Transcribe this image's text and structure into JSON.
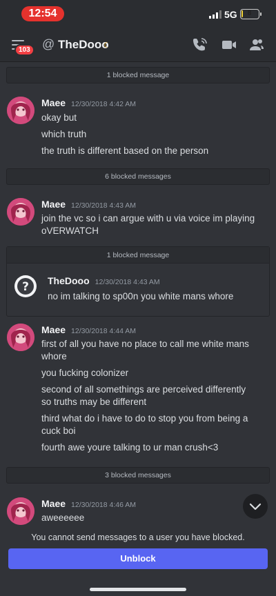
{
  "status_bar": {
    "time": "12:54",
    "network": "5G",
    "battery": "8",
    "battery_level": 0.08
  },
  "header": {
    "notification_count": "103",
    "at_symbol": "@",
    "username": "TheDooo",
    "status_glyph": "☾"
  },
  "feed": [
    {
      "kind": "blocked",
      "text": "1 blocked message"
    },
    {
      "kind": "message",
      "author": "Maee",
      "timestamp": "12/30/2018 4:42 AM",
      "lines": [
        "okay but",
        "which truth",
        "the truth is different based on the person"
      ]
    },
    {
      "kind": "blocked",
      "text": "6 blocked messages"
    },
    {
      "kind": "message",
      "author": "Maee",
      "timestamp": "12/30/2018 4:43 AM",
      "lines": [
        "join the vc so i can argue with u via voice im playing",
        "oVERWATCH"
      ]
    },
    {
      "kind": "blocked_expanded",
      "text": "1 blocked message",
      "message": {
        "author": "TheDooo",
        "timestamp": "12/30/2018 4:43 AM",
        "lines": [
          "no im talking to sp00n you white mans whore"
        ]
      }
    },
    {
      "kind": "message",
      "author": "Maee",
      "timestamp": "12/30/2018 4:44 AM",
      "lines": [
        "first of all you have no place to call me white mans",
        "whore",
        "you fucking colonizer",
        "second of all somethings are perceived  differently",
        "so truths may be different",
        "third what do i have to do to stop you from being a",
        "cuck boi",
        "fourth awe youre talking to ur man crush<3"
      ]
    },
    {
      "kind": "blocked",
      "text": "3 blocked messages"
    },
    {
      "kind": "message",
      "author": "Maee",
      "timestamp": "12/30/2018 4:46 AM",
      "lines": [
        "aweeeeee"
      ]
    }
  ],
  "footer": {
    "notice": "You cannot send messages to a user you have blocked.",
    "unblock_label": "Unblock"
  },
  "colors": {
    "accent": "#5865f2",
    "badge": "#f23f43",
    "time_pill": "#e5322d",
    "background": "#313338"
  },
  "icons": [
    "menu-icon",
    "call-icon",
    "video-icon",
    "members-icon",
    "scroll-down-icon"
  ]
}
